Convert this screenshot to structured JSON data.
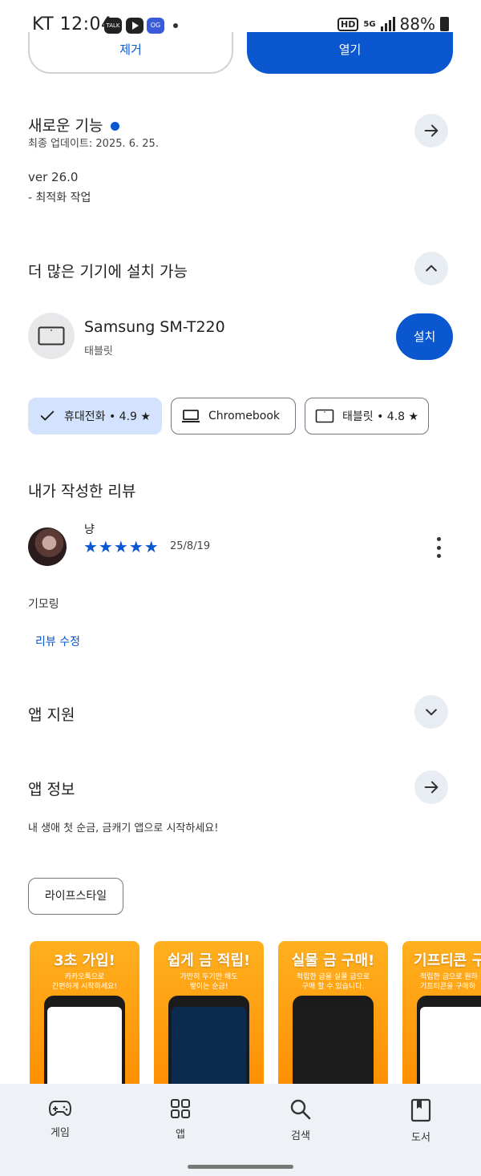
{
  "status_bar": {
    "time": "KT 12:04",
    "talk_label": "TALK",
    "og_label": "OG",
    "hd_label": "HD",
    "network": "5G",
    "battery": "88%"
  },
  "actions": {
    "remove_label": "제거",
    "open_label": "열기"
  },
  "whats_new": {
    "title": "새로운 기능",
    "updated": "최종 업데이트: 2025. 6. 25.",
    "version": "ver 26.0",
    "note": "- 최적화 작업"
  },
  "more_devices": {
    "title": "더 많은 기기에 설치 가능",
    "device_name": "Samsung SM-T220",
    "device_type": "태블릿",
    "install_label": "설치"
  },
  "chips": [
    {
      "label": "휴대전화 • 4.9 ★",
      "selected": true
    },
    {
      "label": "Chromebook",
      "selected": false
    },
    {
      "label": "태블릿 • 4.8 ★",
      "selected": false
    }
  ],
  "my_review": {
    "title": "내가 작성한 리뷰",
    "reviewer": "냥",
    "rating": 5,
    "stars": "★★★★★",
    "date": "25/8/19",
    "text": "기모링",
    "edit_label": "리뷰 수정"
  },
  "app_support": {
    "title": "앱 지원"
  },
  "app_info": {
    "title": "앱 정보",
    "description": "내 생애 첫 순금, 금캐기 앱으로 시작하세요!",
    "tag": "라이프스타일"
  },
  "screenshots": [
    {
      "heading": "3초 가입!",
      "sub": "카카오톡으로\n간편하게 시작하세요!"
    },
    {
      "heading": "쉽게 금 적립!",
      "sub": "가만히 두기만 해도\n쌓이는 순금!"
    },
    {
      "heading": "실물 금 구매!",
      "sub": "적립한 금을 실물 금으로\n구매 할 수 있습니다."
    },
    {
      "heading": "기프티콘 구",
      "sub": "적립한 금으로 원하\n기프티콘을 구매하"
    }
  ],
  "bottom_nav": [
    {
      "label": "게임",
      "icon": "gamepad-icon"
    },
    {
      "label": "앱",
      "icon": "apps-grid-icon"
    },
    {
      "label": "검색",
      "icon": "search-icon"
    },
    {
      "label": "도서",
      "icon": "book-icon"
    }
  ],
  "colors": {
    "accent": "#0b57d0",
    "chip_selected": "#d3e3fd",
    "circle_bg": "#e8edf3",
    "nav_bg": "#eef1f6"
  }
}
